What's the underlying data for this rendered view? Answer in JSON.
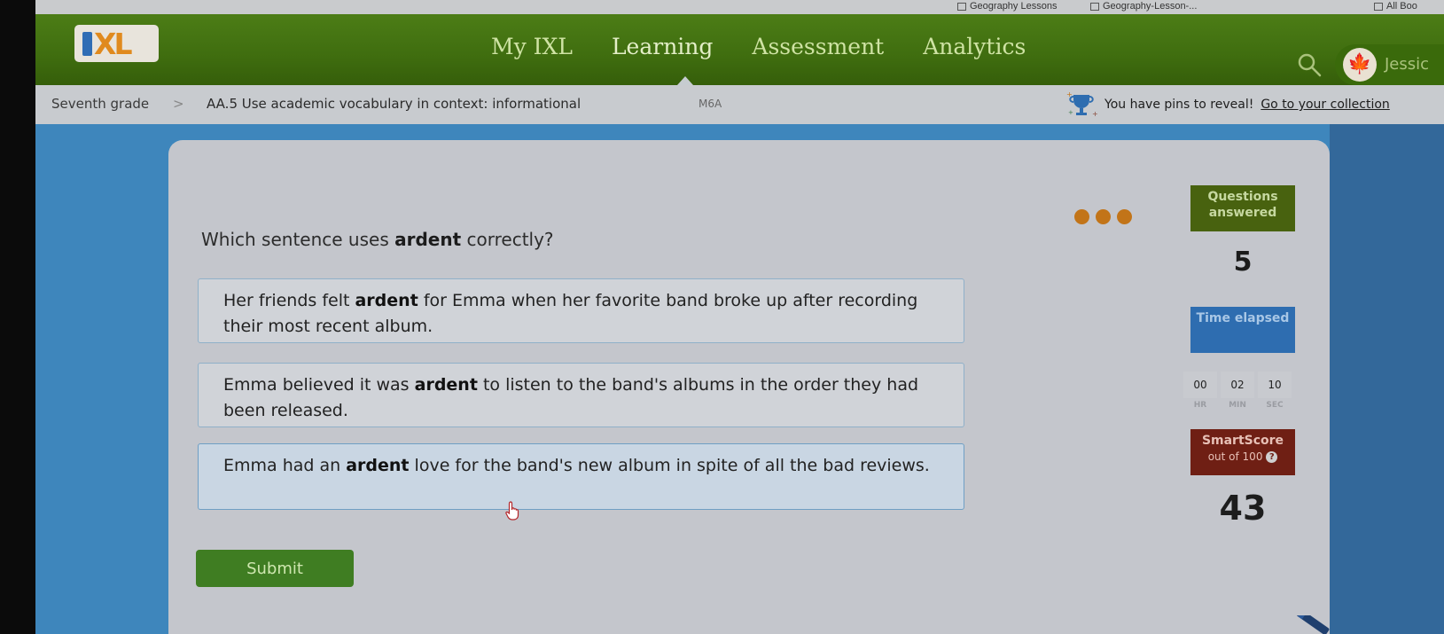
{
  "bookmarks": [
    {
      "label": "Geography Lessons",
      "icon": "folder-icon"
    },
    {
      "label": "Geography-Lesson-...",
      "icon": "page-icon"
    },
    {
      "label": "All Boo",
      "icon": "folder-icon"
    }
  ],
  "nav": {
    "logo": "IXL",
    "links": [
      "My IXL",
      "Learning",
      "Assessment",
      "Analytics"
    ],
    "active": "Learning",
    "user_name": "Jessic",
    "search_icon": "search-icon",
    "avatar_icon": "maple-leaf-icon"
  },
  "breadcrumb": {
    "grade": "Seventh grade",
    "separator": ">",
    "skill": "AA.5 Use academic vocabulary in context: informational",
    "code": "M6A"
  },
  "pins": {
    "message": "You have pins to reveal!",
    "link": "Go to your collection"
  },
  "question": {
    "prefix": "Which sentence uses ",
    "keyword": "ardent",
    "suffix": " correctly?",
    "progress_dots": 3
  },
  "options": [
    {
      "before": "Her friends felt ",
      "keyword": "ardent",
      "after": " for Emma when her favorite band broke up after recording their most recent album.",
      "selected": false
    },
    {
      "before": "Emma believed it was ",
      "keyword": "ardent",
      "after": " to listen to the band's albums in the order they had been released.",
      "selected": false
    },
    {
      "before": "Emma had an ",
      "keyword": "ardent",
      "after": " love for the band's new album in spite of all the bad reviews.",
      "selected": true
    }
  ],
  "submit_label": "Submit",
  "stats": {
    "questions_answered_label": "Questions answered",
    "questions_answered": "5",
    "time_elapsed_label": "Time elapsed",
    "time": {
      "hr": "00",
      "min": "02",
      "sec": "10"
    },
    "time_units": {
      "hr": "HR",
      "min": "MIN",
      "sec": "SEC"
    },
    "smartscore_label": "SmartScore",
    "smartscore_sub": "out of 100",
    "smartscore": "43"
  },
  "colors": {
    "nav_green": "#4c7d16",
    "questions_green": "#48620f",
    "time_blue": "#2e6db0",
    "smartscore_red": "#6f1f14",
    "submit_green": "#3f7d22",
    "dot_orange": "#c27418",
    "background_blue": "#3e86bc"
  }
}
